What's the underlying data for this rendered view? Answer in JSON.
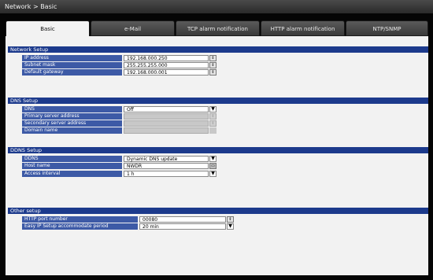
{
  "window": {
    "title": "Network > Basic"
  },
  "tabs": [
    {
      "label": "Basic",
      "active": true
    },
    {
      "label": "e-Mail",
      "active": false
    },
    {
      "label": "TCP alarm notification",
      "active": false
    },
    {
      "label": "HTTP alarm notification",
      "active": false
    },
    {
      "label": "NTP/SNMP",
      "active": false
    }
  ],
  "network_setup": {
    "title": "Network Setup",
    "ip_address": {
      "label": "IP address",
      "value": "192.168.000.250"
    },
    "subnet_mask": {
      "label": "Subnet mask",
      "value": "255.255.255.000"
    },
    "default_gateway": {
      "label": "Default gateway",
      "value": "192.168.000.001"
    }
  },
  "dns_setup": {
    "title": "DNS Setup",
    "dns": {
      "label": "DNS",
      "value": "Off"
    },
    "primary_server": {
      "label": "Primary server address",
      "value": ""
    },
    "secondary_server": {
      "label": "Secondary server address",
      "value": ""
    },
    "domain_name": {
      "label": "Domain name",
      "value": ""
    }
  },
  "ddns_setup": {
    "title": "DDNS Setup",
    "ddns": {
      "label": "DDNS",
      "value": "Dynamic DNS update"
    },
    "host_name": {
      "label": "Host name",
      "value": "NWDR"
    },
    "access_interval": {
      "label": "Access interval",
      "value": "1 h"
    }
  },
  "other_setup": {
    "title": "Other setup",
    "http_port": {
      "label": "HTTP port number",
      "value": "00080"
    },
    "easy_ip": {
      "label": "Easy IP Setup accommodate period",
      "value": "20 min"
    }
  },
  "icons": {
    "spinner": "up-down-arrows",
    "dropdown": "triangle-down"
  },
  "colors": {
    "section": "#1c3a8c",
    "label": "#3d5aa6",
    "panel": "#f2f2f2",
    "background": "#050505"
  }
}
